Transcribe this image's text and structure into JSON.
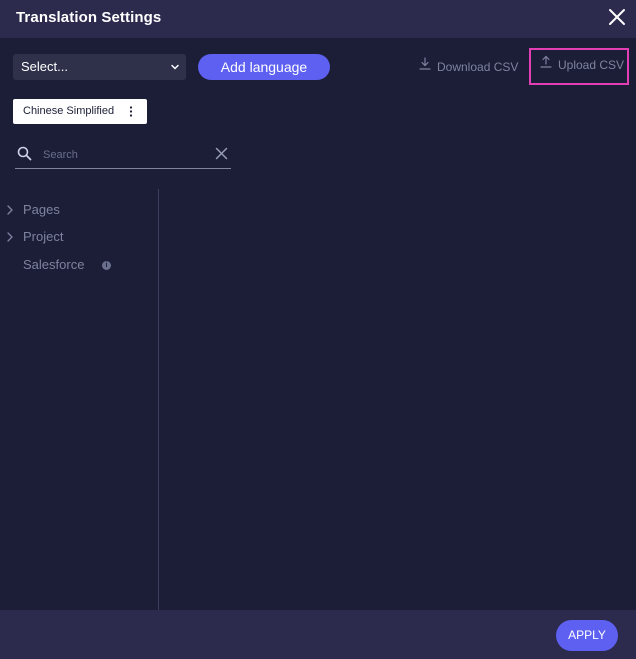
{
  "dialog": {
    "title": "Translation Settings",
    "close_icon": "close-icon"
  },
  "toolbar": {
    "language_select_value": "Select...",
    "add_language_label": "Add language",
    "download_csv_label": "Download CSV",
    "upload_csv_label": "Upload CSV"
  },
  "language_chip": {
    "label": "Chinese Simplified",
    "menu_icon": "kebab-icon"
  },
  "search": {
    "placeholder": "Search",
    "value": ""
  },
  "tree": {
    "items": [
      {
        "label": "Pages",
        "expandable": true
      },
      {
        "label": "Project",
        "expandable": true
      },
      {
        "label": "Salesforce",
        "expandable": false,
        "info_icon": "info-icon"
      }
    ]
  },
  "footer": {
    "apply_label": "APPLY"
  },
  "colors": {
    "background": "#1b1e36",
    "header": "#2c2b4e",
    "accent": "#5e60f2",
    "highlight_border": "#e23fb4",
    "muted_text": "#7f83a0"
  }
}
